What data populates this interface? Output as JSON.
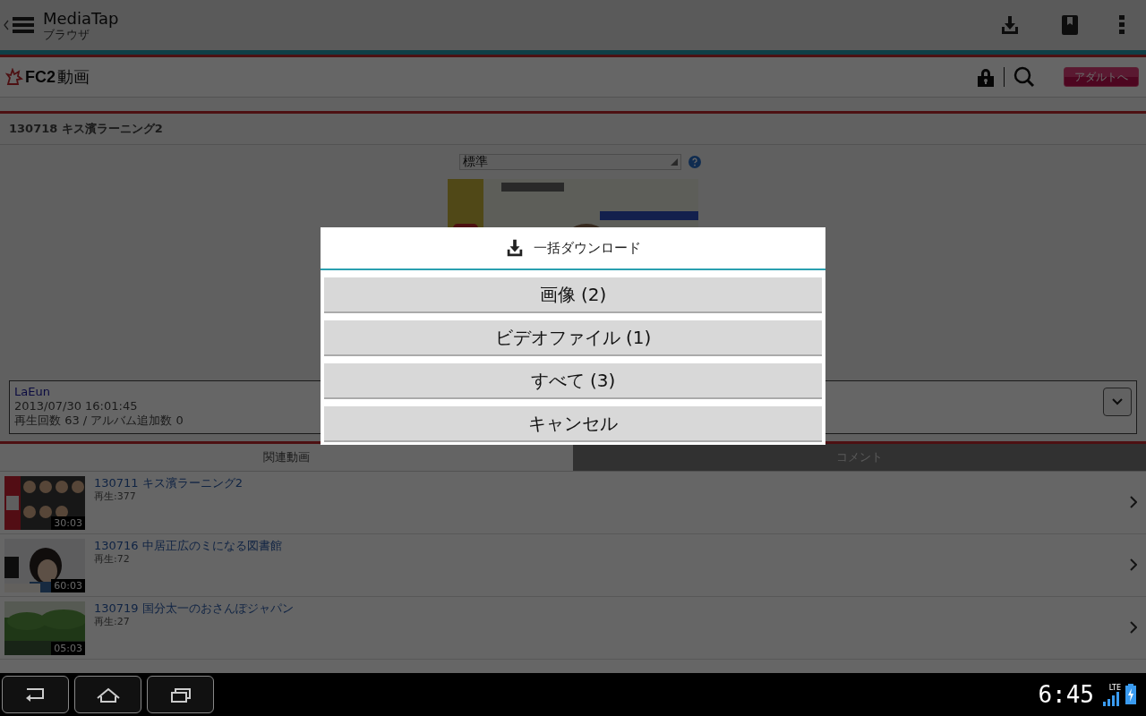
{
  "app_bar": {
    "title": "MediaTap",
    "subtitle": "ブラウザ"
  },
  "site_header": {
    "logo_text": "FC2",
    "logo_suffix": "動画",
    "adult_button": "アダルトへ"
  },
  "video_title": "130718 キス濱ラーニング2",
  "quality_select": {
    "value": "標準"
  },
  "info": {
    "user": "LaEun",
    "date": "2013/07/30 16:01:45",
    "stats": "再生回数 63 / アルバム追加数 0"
  },
  "tabs": [
    {
      "label": "関連動画",
      "selected": true
    },
    {
      "label": "コメント",
      "selected": false
    }
  ],
  "related": [
    {
      "title": "130711 キス濱ラーニング2",
      "plays": "再生:377",
      "duration": "30:03"
    },
    {
      "title": "130716 中居正広のミになる図書館",
      "plays": "再生:72",
      "duration": "60:03"
    },
    {
      "title": "130719 国分太一のおさんぽジャパン",
      "plays": "再生:27",
      "duration": "05:03"
    }
  ],
  "dialog": {
    "title": "一括ダウンロード",
    "buttons": [
      "画像 (2)",
      "ビデオファイル (1)",
      "すべて (3)",
      "キャンセル"
    ]
  },
  "status_bar": {
    "time": "6:45",
    "network": "LTE"
  }
}
